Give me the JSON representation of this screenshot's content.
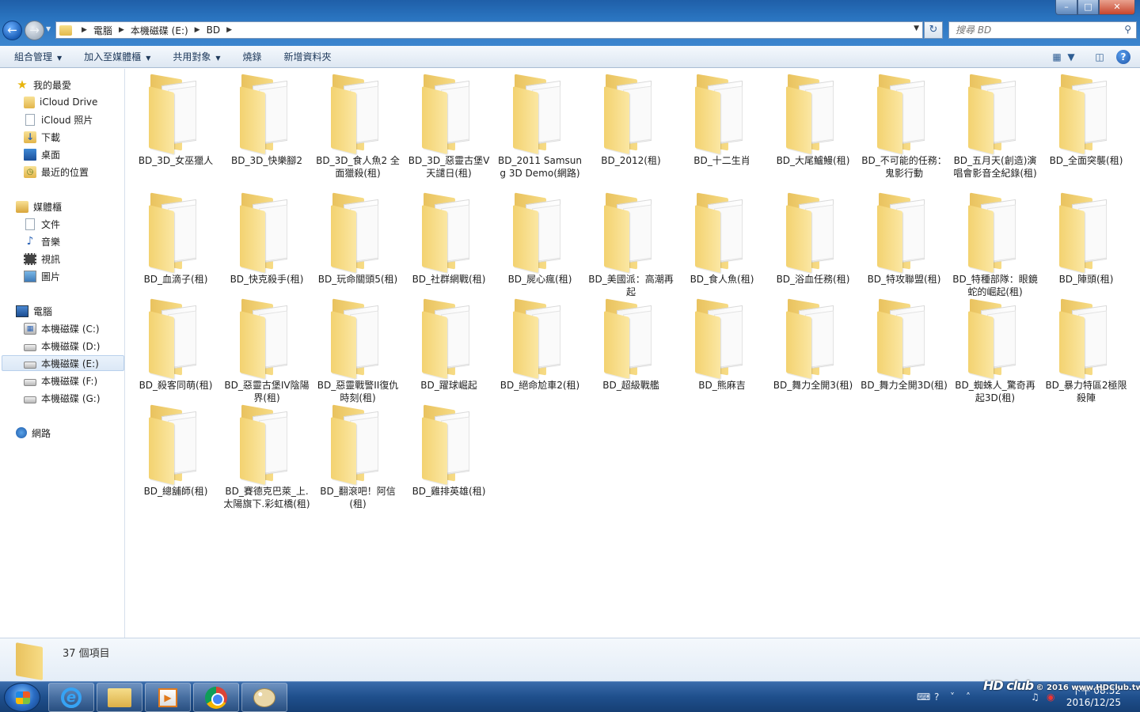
{
  "address": {
    "crumbs": [
      "電腦",
      "本機磁碟 (E:)",
      "BD"
    ],
    "search_placeholder": "搜尋 BD"
  },
  "toolbar": {
    "organize": "組合管理",
    "add_to_library": "加入至媒體櫃",
    "share_with": "共用對象",
    "burn": "燒錄",
    "new_folder": "新增資料夾"
  },
  "sidebar": {
    "favorites": "我的最愛",
    "icloud_drive": "iCloud Drive",
    "icloud_photos": "iCloud 照片",
    "downloads": "下載",
    "desktop": "桌面",
    "recent": "最近的位置",
    "libraries": "媒體櫃",
    "documents": "文件",
    "music": "音樂",
    "videos": "視訊",
    "pictures": "圖片",
    "computer": "電腦",
    "drive_c": "本機磁碟 (C:)",
    "drive_d": "本機磁碟 (D:)",
    "drive_e": "本機磁碟 (E:)",
    "drive_f": "本機磁碟 (F:)",
    "drive_g": "本機磁碟 (G:)",
    "network": "網路"
  },
  "folders": [
    "BD_3D_女巫獵人",
    "BD_3D_快樂腳2",
    "BD_3D_食人魚2 全面獵殺(租)",
    "BD_3D_惡靈古堡V天譴日(租)",
    "BD_2011 Samsung 3D Demo(網路)",
    "BD_2012(租)",
    "BD_十二生肖",
    "BD_大尾鱸鰻(租)",
    "BD_不可能的任務：鬼影行動",
    "BD_五月天(創造)演唱會影音全紀錄(租)",
    "BD_全面突襲(租)",
    "BD_血滴子(租)",
    "BD_快克殺手(租)",
    "BD_玩命關頭5(租)",
    "BD_社群網戰(租)",
    "BD_屍心瘋(租)",
    "BD_美國派：高潮再起",
    "BD_食人魚(租)",
    "BD_浴血任務(租)",
    "BD_特攻聯盟(租)",
    "BD_特種部隊：眼鏡蛇的崛起(租)",
    "BD_陣頭(租)",
    "BD_殺客同萌(租)",
    "BD_惡靈古堡IV陰陽界(租)",
    "BD_惡靈戰警II復仇時刻(租)",
    "BD_躍球崛起",
    "BD_絕命尬車2(租)",
    "BD_超級戰艦",
    "BD_熊麻吉",
    "BD_舞力全開3(租)",
    "BD_舞力全開3D(租)",
    "BD_蜘蛛人_驚奇再起3D(租)",
    "BD_暴力特區2極限殺陣",
    "BD_總舖師(租)",
    "BD_賽德克巴萊_上.太陽旗下.彩虹橋(租)",
    "BD_翻滾吧！阿信(租)",
    "BD_雞排英雄(租)"
  ],
  "status": {
    "item_count": "37 個項目"
  },
  "taskbar": {
    "time": "下午 08:52",
    "date": "2016/12/25"
  },
  "watermark": {
    "logo": "HD club",
    "text": "© 2016 www.HDClub.tw"
  },
  "colors": {
    "accent": "#2a74c0",
    "taskbar": "#1f4f8c",
    "folder": "#f3d270"
  }
}
